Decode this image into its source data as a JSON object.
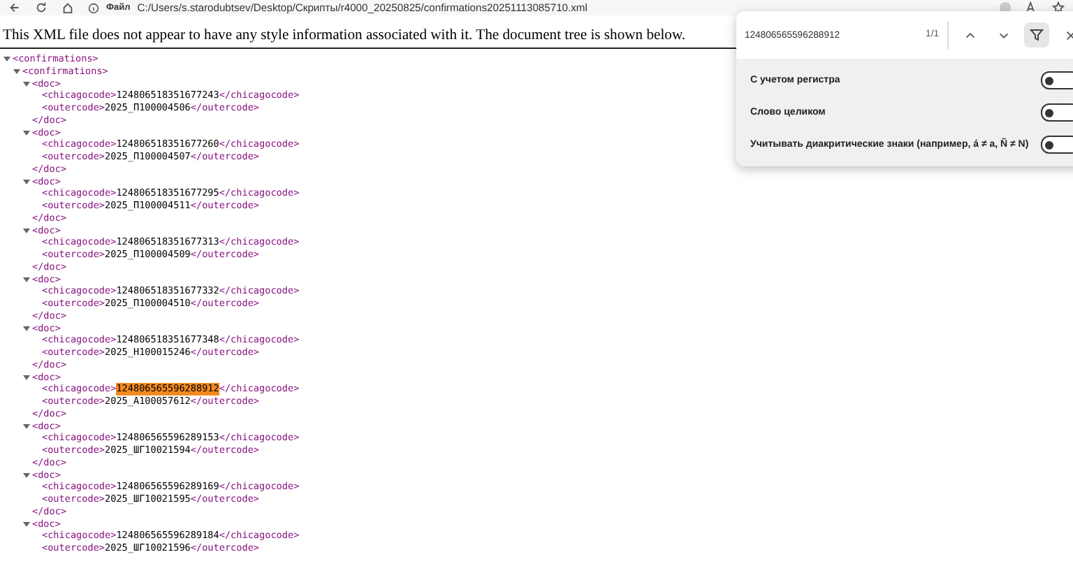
{
  "address_bar": {
    "scheme_label": "Файл",
    "url": "C:/Users/s.starodubtsev/Desktop/Скрипты/r4000_20250825/confirmations20251113085710.xml"
  },
  "notice": "This XML file does not appear to have any style information associated with it. The document tree is shown below.",
  "xml": {
    "kind": "node",
    "open": "<confirmations>",
    "expanded": true,
    "children": [
      {
        "kind": "node",
        "open": "<confirmations>",
        "expanded": true,
        "children": [
          {
            "kind": "node",
            "open": "<doc>",
            "expanded": true,
            "close": "</doc>",
            "children": [
              {
                "kind": "element",
                "open": "<chicagocode>",
                "value": "124806518351677243",
                "close": "</chicagocode>",
                "highlighted": false
              },
              {
                "kind": "element",
                "open": "<outercode>",
                "value": "2025_П100004506",
                "close": "</outercode>",
                "highlighted": false
              }
            ]
          },
          {
            "kind": "node",
            "open": "<doc>",
            "expanded": true,
            "close": "</doc>",
            "children": [
              {
                "kind": "element",
                "open": "<chicagocode>",
                "value": "124806518351677260",
                "close": "</chicagocode>",
                "highlighted": false
              },
              {
                "kind": "element",
                "open": "<outercode>",
                "value": "2025_П100004507",
                "close": "</outercode>",
                "highlighted": false
              }
            ]
          },
          {
            "kind": "node",
            "open": "<doc>",
            "expanded": true,
            "close": "</doc>",
            "children": [
              {
                "kind": "element",
                "open": "<chicagocode>",
                "value": "124806518351677295",
                "close": "</chicagocode>",
                "highlighted": false
              },
              {
                "kind": "element",
                "open": "<outercode>",
                "value": "2025_П100004511",
                "close": "</outercode>",
                "highlighted": false
              }
            ]
          },
          {
            "kind": "node",
            "open": "<doc>",
            "expanded": true,
            "close": "</doc>",
            "children": [
              {
                "kind": "element",
                "open": "<chicagocode>",
                "value": "124806518351677313",
                "close": "</chicagocode>",
                "highlighted": false
              },
              {
                "kind": "element",
                "open": "<outercode>",
                "value": "2025_П100004509",
                "close": "</outercode>",
                "highlighted": false
              }
            ]
          },
          {
            "kind": "node",
            "open": "<doc>",
            "expanded": true,
            "close": "</doc>",
            "children": [
              {
                "kind": "element",
                "open": "<chicagocode>",
                "value": "124806518351677332",
                "close": "</chicagocode>",
                "highlighted": false
              },
              {
                "kind": "element",
                "open": "<outercode>",
                "value": "2025_П100004510",
                "close": "</outercode>",
                "highlighted": false
              }
            ]
          },
          {
            "kind": "node",
            "open": "<doc>",
            "expanded": true,
            "close": "</doc>",
            "children": [
              {
                "kind": "element",
                "open": "<chicagocode>",
                "value": "124806518351677348",
                "close": "</chicagocode>",
                "highlighted": false
              },
              {
                "kind": "element",
                "open": "<outercode>",
                "value": "2025_Н100015246",
                "close": "</outercode>",
                "highlighted": false
              }
            ]
          },
          {
            "kind": "node",
            "open": "<doc>",
            "expanded": true,
            "close": "</doc>",
            "children": [
              {
                "kind": "element",
                "open": "<chicagocode>",
                "value": "124806565596288912",
                "close": "</chicagocode>",
                "highlighted": true
              },
              {
                "kind": "element",
                "open": "<outercode>",
                "value": "2025_А100057612",
                "close": "</outercode>",
                "highlighted": false
              }
            ]
          },
          {
            "kind": "node",
            "open": "<doc>",
            "expanded": true,
            "close": "</doc>",
            "children": [
              {
                "kind": "element",
                "open": "<chicagocode>",
                "value": "124806565596289153",
                "close": "</chicagocode>",
                "highlighted": false
              },
              {
                "kind": "element",
                "open": "<outercode>",
                "value": "2025_ШГ10021594",
                "close": "</outercode>",
                "highlighted": false
              }
            ]
          },
          {
            "kind": "node",
            "open": "<doc>",
            "expanded": true,
            "close": "</doc>",
            "children": [
              {
                "kind": "element",
                "open": "<chicagocode>",
                "value": "124806565596289169",
                "close": "</chicagocode>",
                "highlighted": false
              },
              {
                "kind": "element",
                "open": "<outercode>",
                "value": "2025_ШГ10021595",
                "close": "</outercode>",
                "highlighted": false
              }
            ]
          },
          {
            "kind": "node",
            "open": "<doc>",
            "expanded": true,
            "children": [
              {
                "kind": "element",
                "open": "<chicagocode>",
                "value": "124806565596289184",
                "close": "</chicagocode>",
                "highlighted": false
              },
              {
                "kind": "element",
                "open": "<outercode>",
                "value": "2025_ШГ10021596",
                "close": "</outercode>",
                "highlighted": false
              }
            ]
          }
        ]
      }
    ]
  },
  "find_bar": {
    "query": "124806565596288912",
    "count": "1/1",
    "filter_selected": true,
    "options": [
      {
        "label": "С учетом регистра",
        "on": false
      },
      {
        "label": "Слово целиком",
        "on": false
      },
      {
        "label": "Учитывать диакритические знаки (например, á ≠ a, Ñ ≠ N)",
        "on": false
      }
    ]
  }
}
